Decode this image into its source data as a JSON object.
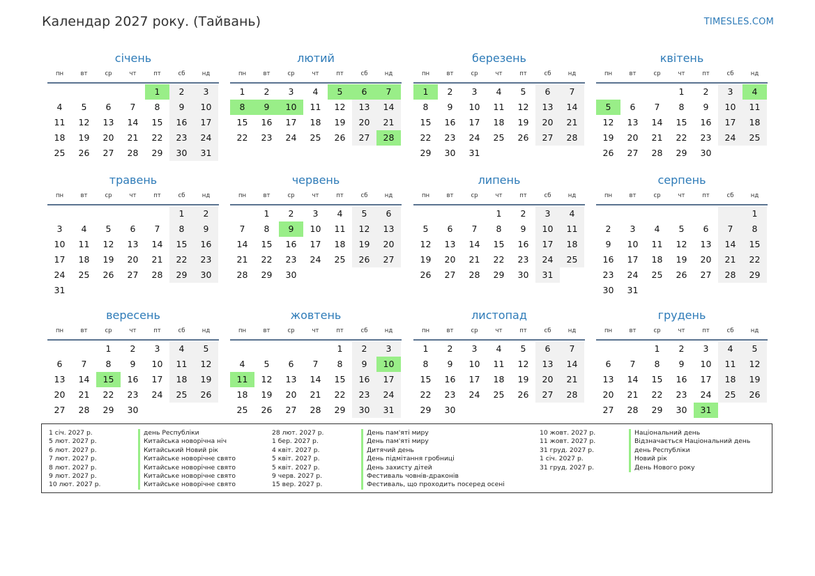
{
  "header": {
    "title": "Календар 2027 року. (Тайвань)",
    "brand": "TIMESLES.COM"
  },
  "colors": {
    "accent": "#2e7bb8",
    "holiday": "#99ee88",
    "weekend": "#f1f1f1"
  },
  "weekdays": [
    "пн",
    "вт",
    "ср",
    "чт",
    "пт",
    "сб",
    "нд"
  ],
  "months": [
    {
      "name": "січень",
      "offset": 4,
      "days": 31,
      "holidays": [
        1
      ]
    },
    {
      "name": "лютий",
      "offset": 0,
      "days": 28,
      "holidays": [
        5,
        6,
        7,
        8,
        9,
        10,
        28
      ]
    },
    {
      "name": "березень",
      "offset": 0,
      "days": 31,
      "holidays": [
        1
      ]
    },
    {
      "name": "квітень",
      "offset": 3,
      "days": 30,
      "holidays": [
        4,
        5
      ]
    },
    {
      "name": "травень",
      "offset": 5,
      "days": 31,
      "holidays": []
    },
    {
      "name": "червень",
      "offset": 1,
      "days": 30,
      "holidays": [
        9
      ]
    },
    {
      "name": "липень",
      "offset": 3,
      "days": 31,
      "holidays": []
    },
    {
      "name": "серпень",
      "offset": 6,
      "days": 31,
      "holidays": []
    },
    {
      "name": "вересень",
      "offset": 2,
      "days": 30,
      "holidays": [
        15
      ]
    },
    {
      "name": "жовтень",
      "offset": 4,
      "days": 31,
      "holidays": [
        10,
        11
      ]
    },
    {
      "name": "листопад",
      "offset": 0,
      "days": 30,
      "holidays": []
    },
    {
      "name": "грудень",
      "offset": 2,
      "days": 31,
      "holidays": [
        31
      ]
    }
  ],
  "holiday_list": [
    [
      {
        "date": "1 січ. 2027 р.",
        "name": "день Республіки"
      },
      {
        "date": "5 лют. 2027 р.",
        "name": "Китайська новорічна ніч"
      },
      {
        "date": "6 лют. 2027 р.",
        "name": "Китайський Новий рік"
      },
      {
        "date": "7 лют. 2027 р.",
        "name": "Китайське новорічне свято"
      },
      {
        "date": "8 лют. 2027 р.",
        "name": "Китайське новорічне свято"
      },
      {
        "date": "9 лют. 2027 р.",
        "name": "Китайське новорічне свято"
      },
      {
        "date": "10 лют. 2027 р.",
        "name": "Китайське новорічне свято"
      }
    ],
    [
      {
        "date": "28 лют. 2027 р.",
        "name": "День пам'яті миру"
      },
      {
        "date": "1 бер. 2027 р.",
        "name": "День пам'яті миру"
      },
      {
        "date": "4 квіт. 2027 р.",
        "name": "Дитячий день"
      },
      {
        "date": "5 квіт. 2027 р.",
        "name": "День підмітання гробниці"
      },
      {
        "date": "5 квіт. 2027 р.",
        "name": "День захисту дітей"
      },
      {
        "date": "9 черв. 2027 р.",
        "name": "Фестиваль човнів-драконів"
      },
      {
        "date": "15 вер. 2027 р.",
        "name": "Фестиваль, що проходить посеред осені"
      }
    ],
    [
      {
        "date": "10 жовт. 2027 р.",
        "name": "Національний день"
      },
      {
        "date": "11 жовт. 2027 р.",
        "name": "Відзначається Національний день"
      },
      {
        "date": "31 груд. 2027 р.",
        "name": "день Республіки"
      },
      {
        "date": "1 січ. 2027 р.",
        "name": "Новий рік"
      },
      {
        "date": "31 груд. 2027 р.",
        "name": "День Нового року"
      }
    ]
  ]
}
